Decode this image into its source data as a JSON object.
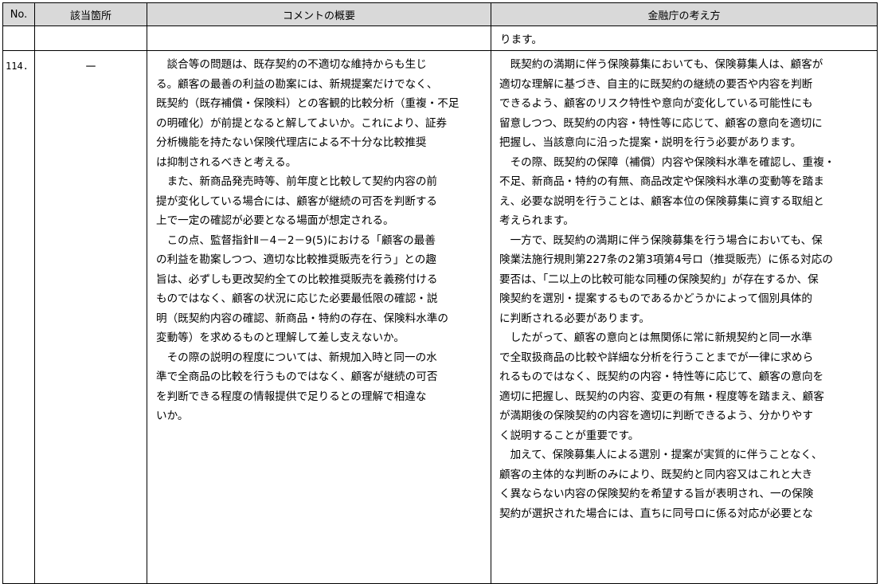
{
  "table": {
    "headers": {
      "no": "No.",
      "location": "該当箇所",
      "comment": "コメントの概要",
      "fsa": "金融庁の考え方"
    },
    "continuation_fsa": "ります。",
    "row": {
      "no": "114.",
      "location": "－",
      "comment_lines": [
        "　談合等の問題は、既存契約の不適切な維持からも生じ",
        "る。顧客の最善の利益の勘案には、新規提案だけでなく、",
        "既契約（既存補償・保険料）との客観的比較分析（重複・不足",
        "の明確化）が前提となると解してよいか。これにより、証券",
        "分析機能を持たない保険代理店による不十分な比較推奨",
        "は抑制されるべきと考える。",
        "　また、新商品発売時等、前年度と比較して契約内容の前",
        "提が変化している場合には、顧客が継続の可否を判断する",
        "上で一定の確認が必要となる場面が想定される。",
        "　この点、監督指針Ⅱ－4－2－9(5)における「顧客の最善",
        "の利益を勘案しつつ、適切な比較推奨販売を行う」との趣",
        "旨は、必ずしも更改契約全ての比較推奨販売を義務付ける",
        "ものではなく、顧客の状況に応じた必要最低限の確認・説",
        "明（既契約内容の確認、新商品・特約の存在、保険料水準の",
        "変動等）を求めるものと理解して差し支えないか。",
        "　その際の説明の程度については、新規加入時と同一の水",
        "準で全商品の比較を行うものではなく、顧客が継続の可否",
        "を判断できる程度の情報提供で足りるとの理解で相違な",
        "いか。"
      ],
      "fsa_lines": [
        "　既契約の満期に伴う保険募集においても、保険募集人は、顧客が",
        "適切な理解に基づき、自主的に既契約の継続の要否や内容を判断",
        "できるよう、顧客のリスク特性や意向が変化している可能性にも",
        "留意しつつ、既契約の内容・特性等に応じて、顧客の意向を適切に",
        "把握し、当該意向に沿った提案・説明を行う必要があります。",
        "　その際、既契約の保障（補償）内容や保険料水準を確認し、重複・",
        "不足、新商品・特約の有無、商品改定や保険料水準の変動等を踏ま",
        "え、必要な説明を行うことは、顧客本位の保険募集に資する取組と",
        "考えられます。",
        "　一方で、既契約の満期に伴う保険募集を行う場合においても、保",
        "険業法施行規則第227条の2第3項第4号ロ（推奨販売）に係る対応の",
        "要否は、「二以上の比較可能な同種の保険契約」が存在するか、保",
        "険契約を選別・提案するものであるかどうかによって個別具体的",
        "に判断される必要があります。",
        "　したがって、顧客の意向とは無関係に常に新規契約と同一水準",
        "で全取扱商品の比較や詳細な分析を行うことまでが一律に求めら",
        "れるものではなく、既契約の内容・特性等に応じて、顧客の意向を",
        "適切に把握し、既契約の内容、変更の有無・程度等を踏まえ、顧客",
        "が満期後の保険契約の内容を適切に判断できるよう、分かりやす",
        "く説明することが重要です。",
        "　加えて、保険募集人による選別・提案が実質的に伴うことなく、",
        "顧客の主体的な判断のみにより、既契約と同内容又はこれと大き",
        "く異ならない内容の保険契約を希望する旨が表明され、一の保険",
        "契約が選択された場合には、直ちに同号ロに係る対応が必要とな"
      ]
    }
  }
}
